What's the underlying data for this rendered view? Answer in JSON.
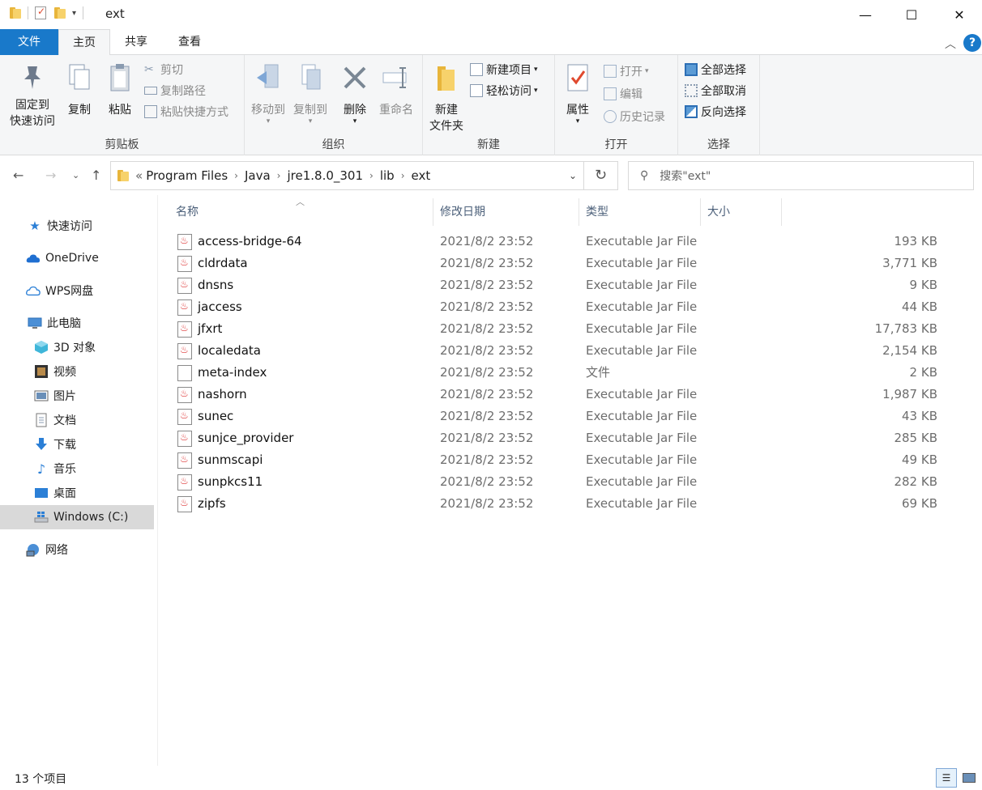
{
  "window": {
    "title": "ext",
    "minimize": "—",
    "maximize": "☐",
    "close": "✕"
  },
  "ribbon_tabs": [
    "文件",
    "主页",
    "共享",
    "查看"
  ],
  "ribbon": {
    "clipboard": {
      "label": "剪贴板",
      "pin_line1": "固定到",
      "pin_line2": "快速访问",
      "copy": "复制",
      "paste": "粘贴",
      "cut": "剪切",
      "copy_path": "复制路径",
      "paste_shortcut": "粘贴快捷方式"
    },
    "organize": {
      "label": "组织",
      "move_to": "移动到",
      "copy_to": "复制到",
      "delete": "删除",
      "rename": "重命名"
    },
    "new": {
      "label": "新建",
      "new_folder_line1": "新建",
      "new_folder_line2": "文件夹",
      "new_item": "新建项目",
      "easy_access": "轻松访问"
    },
    "open": {
      "label": "打开",
      "properties": "属性",
      "open": "打开",
      "edit": "编辑",
      "history": "历史记录"
    },
    "select": {
      "label": "选择",
      "select_all": "全部选择",
      "select_none": "全部取消",
      "invert": "反向选择"
    }
  },
  "address": {
    "prefix": "«",
    "crumbs": [
      "Program Files",
      "Java",
      "jre1.8.0_301",
      "lib",
      "ext"
    ],
    "search_placeholder": "搜索\"ext\""
  },
  "nav": {
    "quick_access": "快速访问",
    "onedrive": "OneDrive",
    "wps": "WPS网盘",
    "this_pc": "此电脑",
    "objects3d": "3D 对象",
    "videos": "视频",
    "pictures": "图片",
    "documents": "文档",
    "downloads": "下载",
    "music": "音乐",
    "desktop": "桌面",
    "drive_c": "Windows (C:)",
    "network": "网络"
  },
  "columns": {
    "name": "名称",
    "date": "修改日期",
    "type": "类型",
    "size": "大小"
  },
  "files": [
    {
      "name": "access-bridge-64",
      "date": "2021/8/2 23:52",
      "type": "Executable Jar File",
      "size": "193 KB",
      "icon": "jar"
    },
    {
      "name": "cldrdata",
      "date": "2021/8/2 23:52",
      "type": "Executable Jar File",
      "size": "3,771 KB",
      "icon": "jar"
    },
    {
      "name": "dnsns",
      "date": "2021/8/2 23:52",
      "type": "Executable Jar File",
      "size": "9 KB",
      "icon": "jar"
    },
    {
      "name": "jaccess",
      "date": "2021/8/2 23:52",
      "type": "Executable Jar File",
      "size": "44 KB",
      "icon": "jar"
    },
    {
      "name": "jfxrt",
      "date": "2021/8/2 23:52",
      "type": "Executable Jar File",
      "size": "17,783 KB",
      "icon": "jar"
    },
    {
      "name": "localedata",
      "date": "2021/8/2 23:52",
      "type": "Executable Jar File",
      "size": "2,154 KB",
      "icon": "jar"
    },
    {
      "name": "meta-index",
      "date": "2021/8/2 23:52",
      "type": "文件",
      "size": "2 KB",
      "icon": "file"
    },
    {
      "name": "nashorn",
      "date": "2021/8/2 23:52",
      "type": "Executable Jar File",
      "size": "1,987 KB",
      "icon": "jar"
    },
    {
      "name": "sunec",
      "date": "2021/8/2 23:52",
      "type": "Executable Jar File",
      "size": "43 KB",
      "icon": "jar"
    },
    {
      "name": "sunjce_provider",
      "date": "2021/8/2 23:52",
      "type": "Executable Jar File",
      "size": "285 KB",
      "icon": "jar"
    },
    {
      "name": "sunmscapi",
      "date": "2021/8/2 23:52",
      "type": "Executable Jar File",
      "size": "49 KB",
      "icon": "jar"
    },
    {
      "name": "sunpkcs11",
      "date": "2021/8/2 23:52",
      "type": "Executable Jar File",
      "size": "282 KB",
      "icon": "jar"
    },
    {
      "name": "zipfs",
      "date": "2021/8/2 23:52",
      "type": "Executable Jar File",
      "size": "69 KB",
      "icon": "jar"
    }
  ],
  "status": {
    "count": "13 个项目"
  },
  "colors": {
    "accent": "#1979ca",
    "ribbon_bg": "#f5f6f7",
    "selected_nav": "#d9d9d9"
  }
}
